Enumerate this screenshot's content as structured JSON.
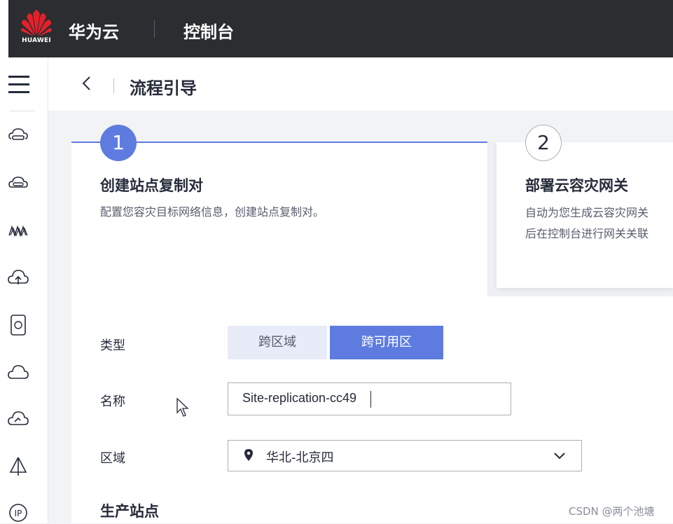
{
  "brand": {
    "logo_word": "HUAWEI",
    "name": "华为云",
    "console": "控制台"
  },
  "header": {
    "title": "流程引导"
  },
  "sidebar": {
    "icons": [
      "menu-icon",
      "cloud-server-icon",
      "cloud-disk-icon",
      "network-wave-icon",
      "cloud-upload-icon",
      "storage-device-icon",
      "cloud-icon",
      "cloud-backup-icon",
      "sail-icon",
      "ip-icon"
    ]
  },
  "steps": [
    {
      "number": "1",
      "title": "创建站点复制对",
      "desc": "配置您容灾目标网络信息，创建站点复制对。",
      "state": "active"
    },
    {
      "number": "2",
      "title": "部署云容灾网关",
      "desc_lines": [
        "自动为您生成云容灾网关",
        "后在控制台进行网关关联"
      ],
      "state": "inactive"
    }
  ],
  "form": {
    "type_label": "类型",
    "type_options": [
      "跨区域",
      "跨可用区"
    ],
    "type_selected": "跨可用区",
    "name_label": "名称",
    "name_value": "Site-replication-cc49",
    "region_label": "区域",
    "region_value": "华北-北京四",
    "section_title": "生产站点"
  },
  "colors": {
    "accent": "#5e7ce0",
    "topbar": "#2b2d30",
    "huawei_red": "#e3202a"
  },
  "watermark": "CSDN @两个池塘"
}
